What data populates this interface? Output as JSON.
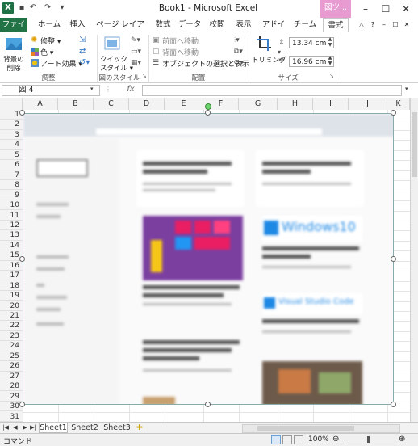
{
  "window": {
    "title": "Book1 - Microsoft Excel",
    "contextual_group": "図ツ...",
    "app_icon": "X",
    "minimize": "–",
    "restore": "☐",
    "close": "✕"
  },
  "quick_access": {
    "save": "▪",
    "undo": "↶",
    "redo": "↷",
    "customize": "▾"
  },
  "tabs": [
    {
      "label": "ファイル"
    },
    {
      "label": "ホーム"
    },
    {
      "label": "挿入"
    },
    {
      "label": "ページ レイアウト"
    },
    {
      "label": "数式"
    },
    {
      "label": "データ"
    },
    {
      "label": "校閲"
    },
    {
      "label": "表示"
    },
    {
      "label": "アドイン"
    },
    {
      "label": "チーム"
    },
    {
      "label": "書式"
    }
  ],
  "tab_right_icons": [
    "△",
    "?",
    "–",
    "☐",
    "✕"
  ],
  "ribbon": {
    "adjust": {
      "remove_bg": "背景の\n削除",
      "remove_bg_line1": "背景の",
      "remove_bg_line2": "削除",
      "corrections": "修整 ▾",
      "color": "色 ▾",
      "artistic": "アート効果 ▾",
      "group_label": "調整"
    },
    "picture_styles": {
      "quick_styles": "クイック",
      "quick_styles2": "スタイル ▾",
      "group_label": "図のスタイル"
    },
    "arrange": {
      "bring_forward": "前面へ移動",
      "send_backward": "背面へ移動",
      "selection_pane": "オブジェクトの選択と表示",
      "group_label": "配置"
    },
    "size": {
      "crop": "トリミング",
      "height": "13.34 cm",
      "width": "16.96 cm",
      "group_label": "サイズ"
    }
  },
  "formula_bar": {
    "name_box": "図 4",
    "fx": "fx",
    "value": ""
  },
  "columns": [
    "A",
    "B",
    "C",
    "D",
    "E",
    "F",
    "G",
    "H",
    "I",
    "J",
    "K"
  ],
  "rows": [
    "1",
    "2",
    "3",
    "4",
    "5",
    "6",
    "7",
    "8",
    "9",
    "10",
    "11",
    "12",
    "13",
    "14",
    "15",
    "16",
    "17",
    "18",
    "19",
    "20",
    "21",
    "22",
    "23",
    "24",
    "25",
    "26",
    "27",
    "28",
    "29",
    "30",
    "31"
  ],
  "picture": {
    "win_title": "Windows10",
    "vs_title": "Visual Studio Code"
  },
  "sheets": [
    "Sheet1",
    "Sheet2",
    "Sheet3"
  ],
  "status": {
    "mode": "コマンド",
    "zoom": "100%"
  },
  "colors": {
    "excel_green": "#217346",
    "context_pink": "#e79bd1",
    "grid_line": "#e4e4e4",
    "header_bg": "#f3f3f3"
  }
}
